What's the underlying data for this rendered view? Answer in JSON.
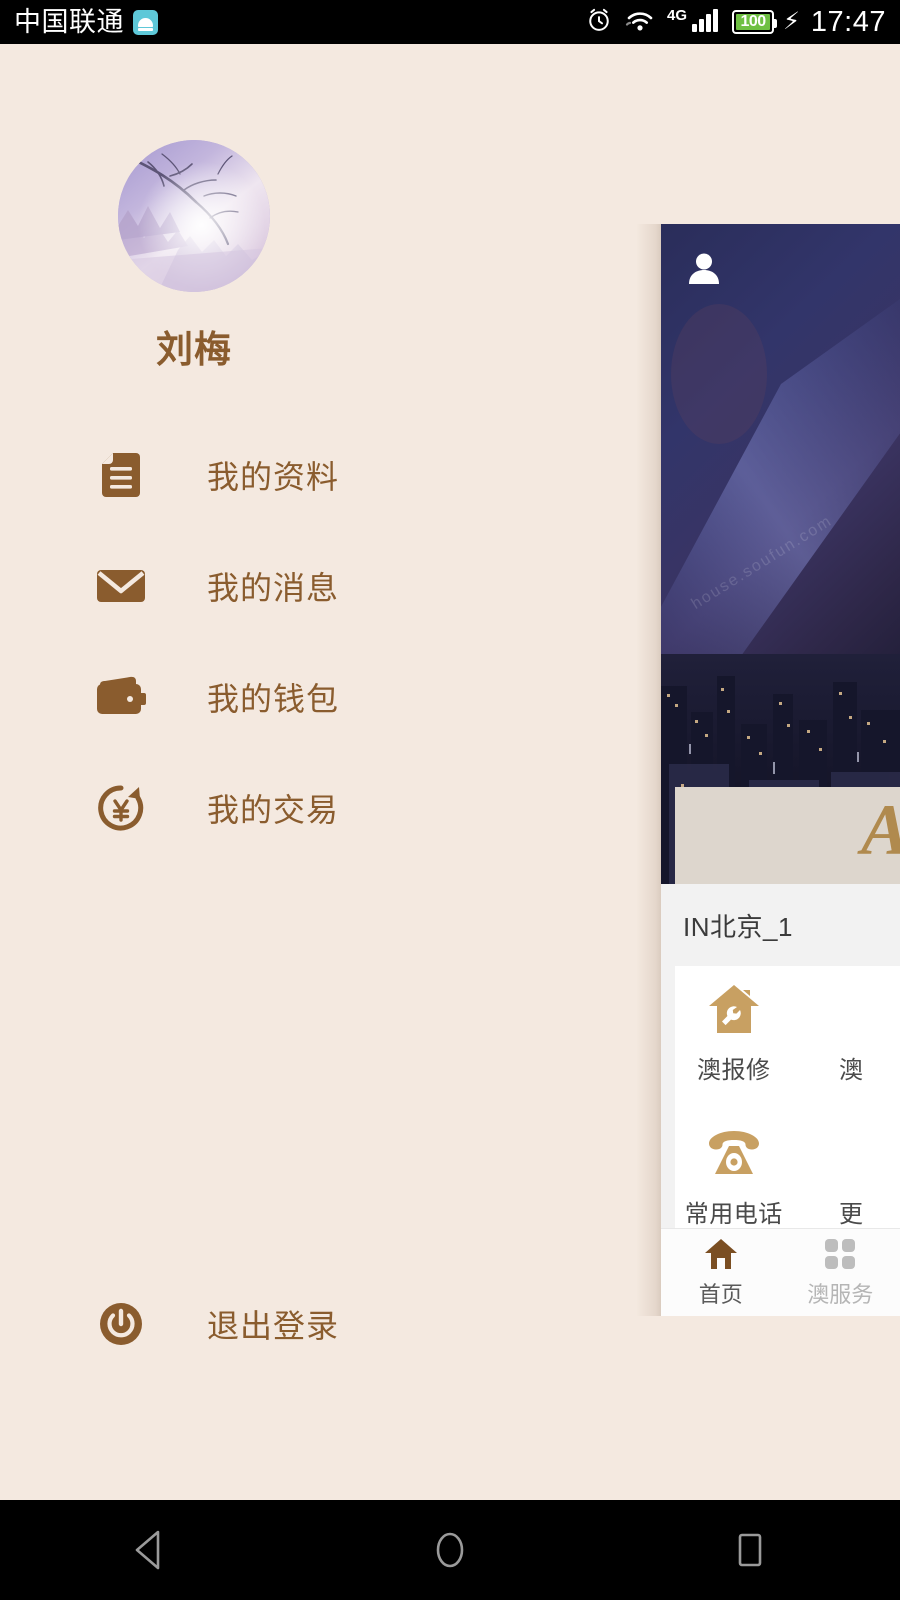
{
  "status_bar": {
    "carrier": "中国联通",
    "android_chip_icon": "android-robot-icon",
    "alarm_icon": "alarm-clock-icon",
    "wifi_icon": "wifi-icon",
    "network_type": "4G",
    "signal_icon": "cellular-signal-icon",
    "battery_level": "100",
    "charging_icon": "lightning-bolt-icon",
    "clock": "17:47"
  },
  "drawer": {
    "avatar_alt": "user-avatar",
    "profile_name": "刘梅",
    "menu_items": [
      {
        "label": "我的资料",
        "icon": "document-icon"
      },
      {
        "label": "我的消息",
        "icon": "envelope-icon"
      },
      {
        "label": "我的钱包",
        "icon": "wallet-icon"
      },
      {
        "label": "我的交易",
        "icon": "yuan-refresh-icon"
      }
    ],
    "logout": {
      "label": "退出登录",
      "icon": "power-icon"
    },
    "accent_color": "#8a5c2e",
    "background_color": "#f4e9e0"
  },
  "app_panel": {
    "hero": {
      "user_icon": "person-icon",
      "watermark": "house.soufun.com",
      "watermark2": "soufun.com"
    },
    "brand_card": {
      "letter": "A"
    },
    "community_name": "IN北京_1",
    "services": [
      {
        "label": "澳报修",
        "icon": "house-repair-icon"
      },
      {
        "label": "澳",
        "icon": "service-icon-partial"
      },
      {
        "label": "常用电话",
        "icon": "telephone-icon"
      },
      {
        "label": "更",
        "icon": "more-icon-partial"
      }
    ],
    "tabs": [
      {
        "label": "首页",
        "icon": "home-icon",
        "active": true
      },
      {
        "label": "澳服务",
        "icon": "grid-icon",
        "active": false
      }
    ],
    "icon_color": "#c8a062"
  },
  "nav_bar": {
    "back": "back-triangle-icon",
    "home": "home-circle-icon",
    "recents": "recents-square-icon"
  }
}
